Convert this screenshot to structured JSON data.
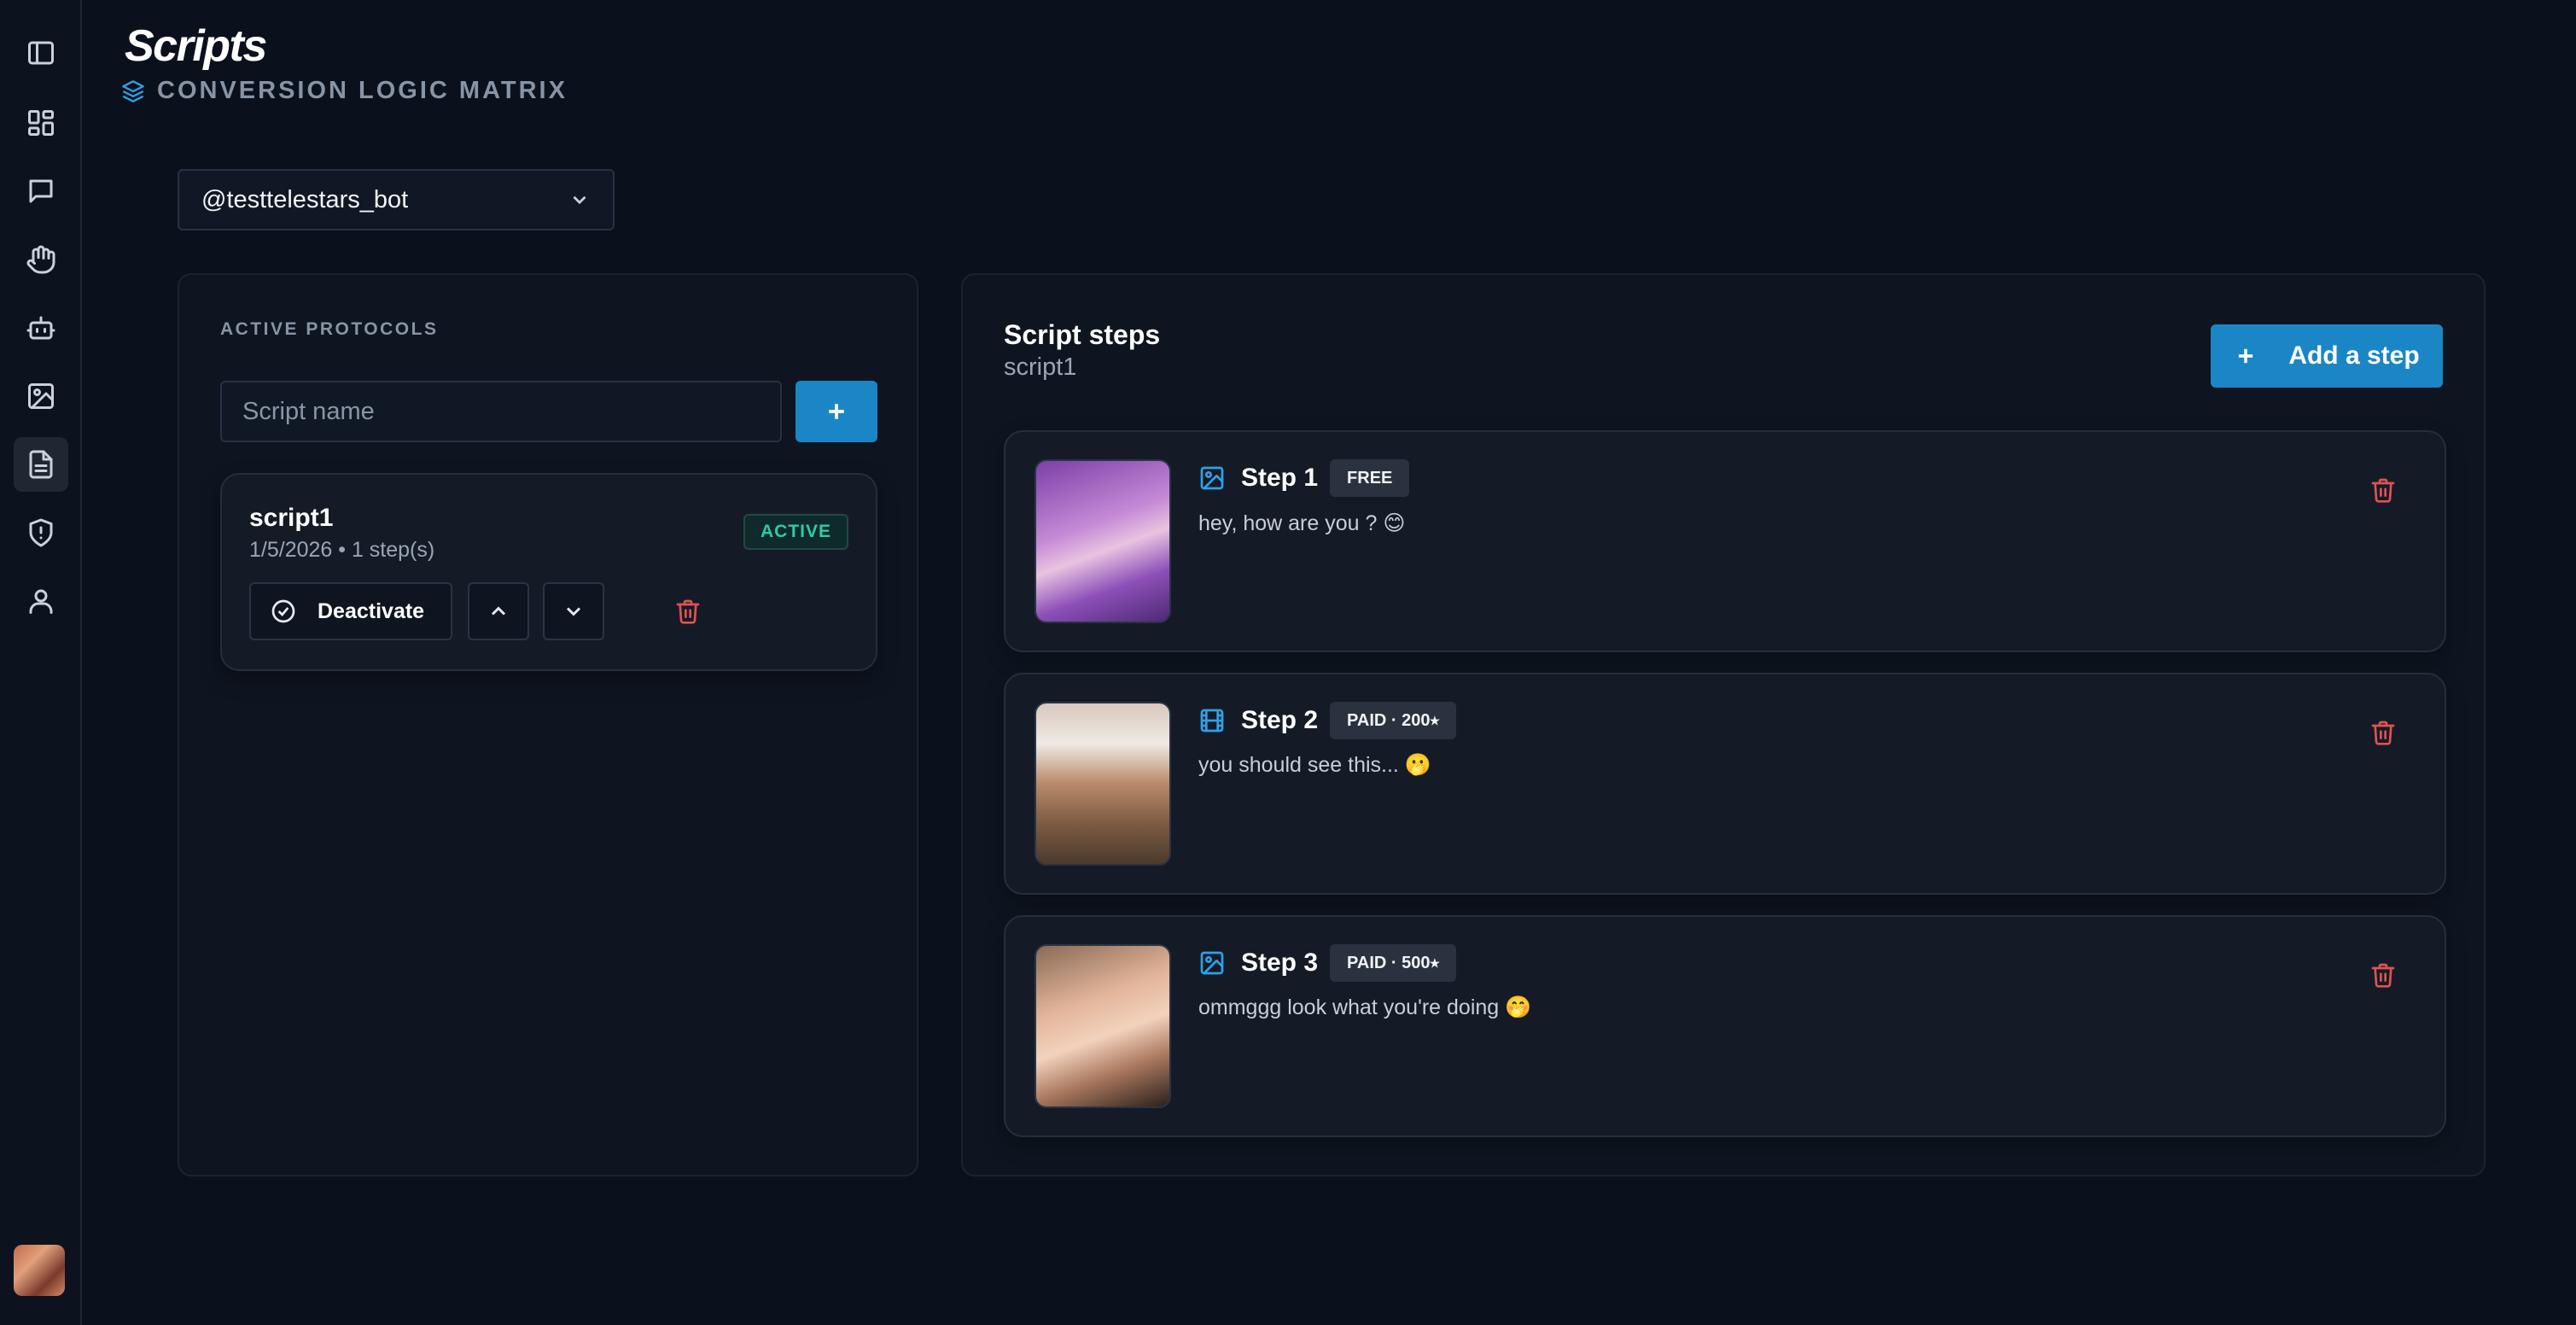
{
  "sidebar": {
    "items": [
      {
        "icon": "sidebar-toggle-icon",
        "active": false
      },
      {
        "icon": "dashboard-icon",
        "active": false
      },
      {
        "icon": "chat-icon",
        "active": false
      },
      {
        "icon": "hand-icon",
        "active": false
      },
      {
        "icon": "bot-icon",
        "active": false
      },
      {
        "icon": "image-icon",
        "active": false
      },
      {
        "icon": "document-icon",
        "active": true
      },
      {
        "icon": "shield-icon",
        "active": false
      },
      {
        "icon": "user-icon",
        "active": false
      }
    ]
  },
  "header": {
    "title": "Scripts",
    "subtitle": "CONVERSION LOGIC MATRIX"
  },
  "bot_selector": {
    "selected": "@testtelestars_bot"
  },
  "left_panel": {
    "section_label": "ACTIVE PROTOCOLS",
    "name_input_placeholder": "Script name",
    "scripts": [
      {
        "name": "script1",
        "meta": "1/5/2026 • 1 step(s)",
        "status": "ACTIVE",
        "deactivate_label": "Deactivate"
      }
    ]
  },
  "right_panel": {
    "title": "Script steps",
    "subtitle": "script1",
    "add_step_label": "Add a step",
    "steps": [
      {
        "label": "Step 1",
        "media_icon": "image-icon",
        "price": "FREE",
        "text": "hey, how are you ? 😊"
      },
      {
        "label": "Step 2",
        "media_icon": "film-icon",
        "price": "PAID · 200⭑",
        "text": "you should see this... 🫢"
      },
      {
        "label": "Step 3",
        "media_icon": "image-icon",
        "price": "PAID · 500⭑",
        "text": "ommggg look what you're doing 🤭"
      }
    ]
  },
  "colors": {
    "accent": "#1b86c6",
    "active_badge": "#2fcaa4",
    "danger": "#e05252",
    "background": "#0b111c"
  }
}
